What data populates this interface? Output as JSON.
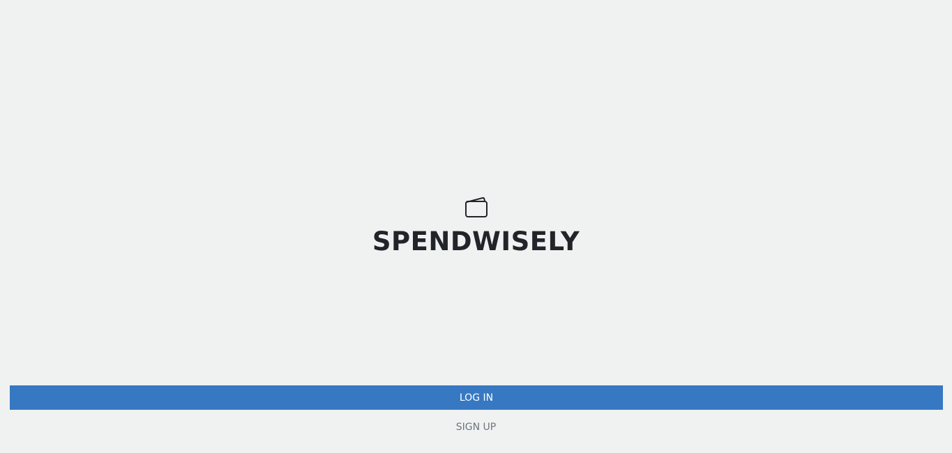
{
  "brand": {
    "icon": "wallet-icon",
    "title": "SPENDWISELY"
  },
  "actions": {
    "login_label": "LOG IN",
    "signup_label": "SIGN UP"
  },
  "colors": {
    "background": "#f0f2f2",
    "primary": "#3778c2",
    "title_text": "#212529",
    "muted_text": "#6c757d"
  }
}
